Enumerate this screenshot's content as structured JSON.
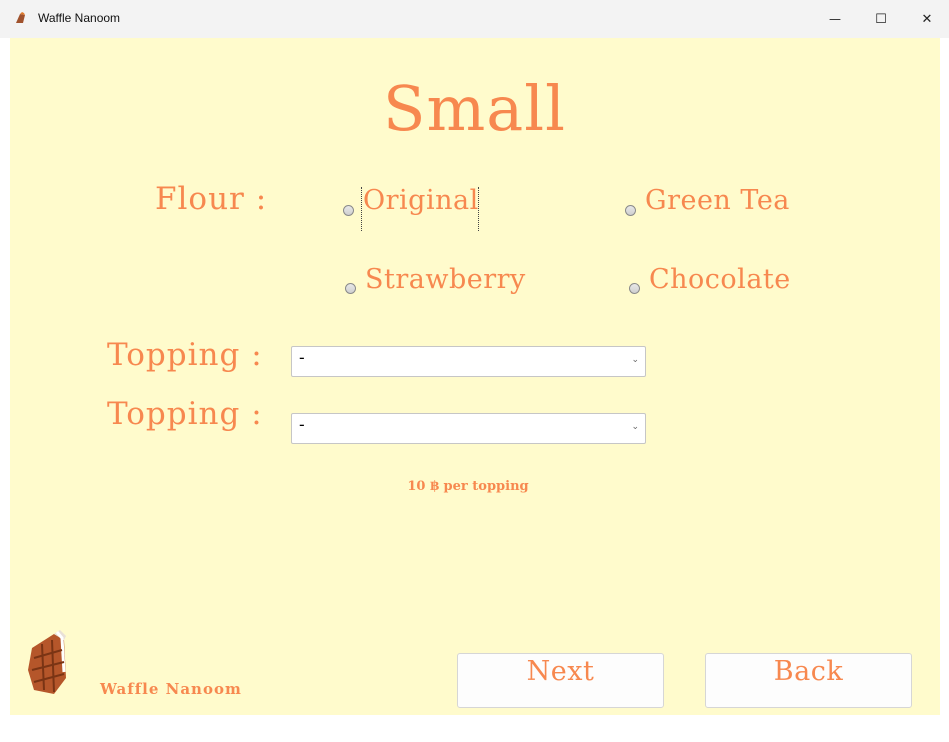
{
  "window": {
    "title": "Waffle Nanoom",
    "minimize_glyph": "—",
    "maximize_glyph": "☐",
    "close_glyph": "✕"
  },
  "heading": "Small",
  "flour": {
    "label": "Flour :",
    "options": [
      {
        "label": "Original",
        "selected": false
      },
      {
        "label": "Green Tea",
        "selected": false
      },
      {
        "label": "Strawberry",
        "selected": false
      },
      {
        "label": "Chocolate",
        "selected": false
      }
    ]
  },
  "toppings": [
    {
      "label": "Topping :",
      "value": "-"
    },
    {
      "label": "Topping :",
      "value": "-"
    }
  ],
  "price_note": "10 ฿ per topping",
  "brand": "Waffle Nanoom",
  "buttons": {
    "next": "Next",
    "back": "Back"
  },
  "colors": {
    "accent": "#f7884f",
    "background": "#fffbcc",
    "titlebar": "#f3f3f3"
  }
}
